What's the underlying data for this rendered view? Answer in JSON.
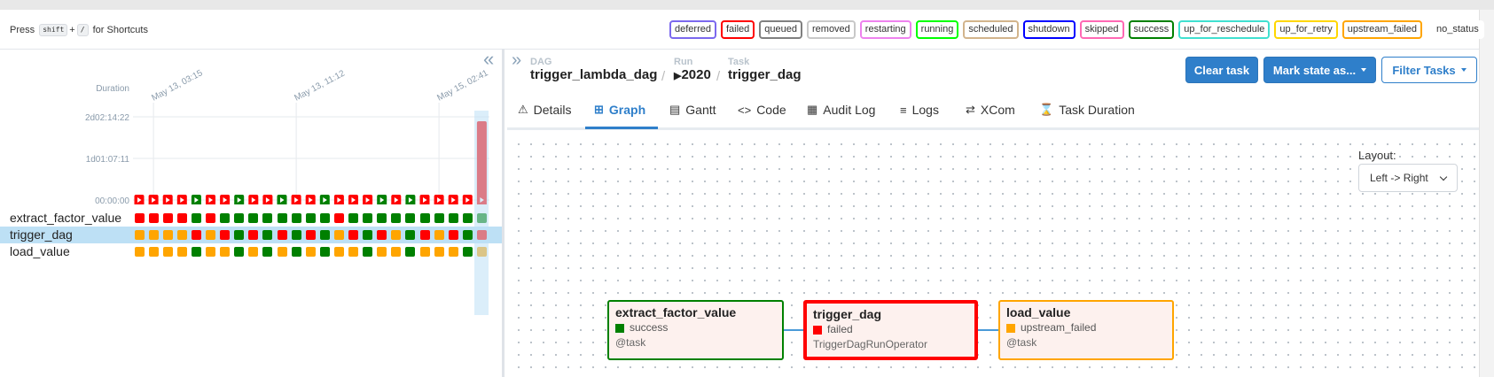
{
  "shortcuts": {
    "prefix": "Press",
    "key1": "shift",
    "plus": "+",
    "key2": "/",
    "suffix": "for Shortcuts"
  },
  "legend": [
    {
      "label": "deferred",
      "color": "#7b68ee"
    },
    {
      "label": "failed",
      "color": "#ff0000"
    },
    {
      "label": "queued",
      "color": "#808080"
    },
    {
      "label": "removed",
      "color": "#c8c8c8"
    },
    {
      "label": "restarting",
      "color": "#ee82ee"
    },
    {
      "label": "running",
      "color": "#00ff00"
    },
    {
      "label": "scheduled",
      "color": "#d2b48c"
    },
    {
      "label": "shutdown",
      "color": "#0000ff"
    },
    {
      "label": "skipped",
      "color": "#ff69b4"
    },
    {
      "label": "success",
      "color": "#008000"
    },
    {
      "label": "up_for_reschedule",
      "color": "#40e0d0"
    },
    {
      "label": "up_for_retry",
      "color": "#ffd700"
    },
    {
      "label": "upstream_failed",
      "color": "#ffa500"
    },
    {
      "label": "no_status",
      "color": "transparent"
    }
  ],
  "grid": {
    "duration_label": "Duration",
    "y_ticks": [
      "2d02:14:22",
      "1d01:07:11",
      "00:00:00"
    ],
    "x_dates": [
      "May 13, 03:15",
      "May 13, 11:12",
      "May 15, 02:41"
    ],
    "run_states": [
      "failed",
      "failed",
      "failed",
      "failed",
      "success",
      "failed",
      "failed",
      "success",
      "failed",
      "failed",
      "success",
      "failed",
      "failed",
      "success",
      "failed",
      "failed",
      "failed",
      "success",
      "failed",
      "success",
      "failed",
      "failed",
      "failed",
      "failed",
      "failed"
    ],
    "last_run_duration_fraction": 1.0,
    "tasks": [
      {
        "name": "extract_factor_value",
        "states": [
          "failed",
          "failed",
          "failed",
          "failed",
          "success",
          "failed",
          "success",
          "success",
          "success",
          "success",
          "success",
          "success",
          "success",
          "success",
          "failed",
          "success",
          "success",
          "success",
          "success",
          "success",
          "success",
          "success",
          "success",
          "success",
          "success"
        ]
      },
      {
        "name": "trigger_dag",
        "states": [
          "upstream_failed",
          "upstream_failed",
          "upstream_failed",
          "upstream_failed",
          "failed",
          "upstream_failed",
          "failed",
          "success",
          "failed",
          "success",
          "failed",
          "success",
          "failed",
          "success",
          "upstream_failed",
          "failed",
          "success",
          "failed",
          "upstream_failed",
          "success",
          "failed",
          "upstream_failed",
          "failed",
          "success",
          "failed"
        ]
      },
      {
        "name": "load_value",
        "states": [
          "upstream_failed",
          "upstream_failed",
          "upstream_failed",
          "upstream_failed",
          "success",
          "upstream_failed",
          "upstream_failed",
          "success",
          "upstream_failed",
          "success",
          "upstream_failed",
          "success",
          "upstream_failed",
          "success",
          "upstream_failed",
          "upstream_failed",
          "success",
          "upstream_failed",
          "upstream_failed",
          "success",
          "upstream_failed",
          "upstream_failed",
          "upstream_failed",
          "success",
          "upstream_failed"
        ]
      }
    ],
    "selected_task": "trigger_dag"
  },
  "breadcrumb": {
    "dag_label": "DAG",
    "dag": "trigger_lambda_dag",
    "run_label": "Run",
    "run": "2020",
    "task_label": "Task",
    "task": "trigger_dag"
  },
  "actions": {
    "clear": "Clear task",
    "mark": "Mark state as...",
    "filter": "Filter Tasks"
  },
  "tabs": [
    "Details",
    "Graph",
    "Gantt",
    "Code",
    "Audit Log",
    "Logs",
    "XCom",
    "Task Duration"
  ],
  "active_tab": "Graph",
  "layout": {
    "label": "Layout:",
    "value": "Left -> Right"
  },
  "nodes": [
    {
      "name": "extract_factor_value",
      "state": "success",
      "subtitle": "@task",
      "border": "#008000",
      "stateColor": "#008000"
    },
    {
      "name": "trigger_dag",
      "state": "failed",
      "subtitle": "TriggerDagRunOperator",
      "border": "#ff0000",
      "stateColor": "#ff0000"
    },
    {
      "name": "load_value",
      "state": "upstream_failed",
      "subtitle": "@task",
      "border": "#ffa500",
      "stateColor": "#ffa500"
    }
  ]
}
